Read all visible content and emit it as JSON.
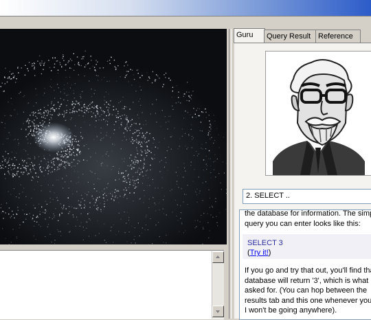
{
  "tabs": [
    {
      "label": "Guru",
      "active": true
    },
    {
      "label": "Query Result",
      "active": false
    },
    {
      "label": "Reference",
      "active": false
    }
  ],
  "lesson_selector": {
    "value": "2. SELECT .."
  },
  "lesson": {
    "para1": [
      "the database for information. The simp",
      "query you can enter looks like this:"
    ],
    "code": "SELECT 3",
    "try_open": "(",
    "try_label": "Try it!",
    "try_close": ")",
    "para2": [
      "If you go and try that out, you'll find tha",
      "database will return '3', which is what",
      "asked for. (You can hop between the",
      "results tab and this one whenever you",
      "I won't be going anywhere)."
    ]
  },
  "colors": {
    "titlebar_start": "#ffffff",
    "titlebar_end": "#2c5cc9",
    "galaxy_bg": "#0b0d10",
    "link": "#0000ee",
    "code": "#2b2b9e"
  }
}
